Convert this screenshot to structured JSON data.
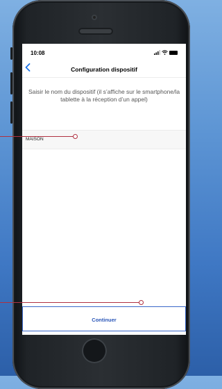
{
  "status_bar": {
    "time": "10:08"
  },
  "nav": {
    "title": "Configuration dispositif",
    "back_icon": "chevron-left-icon"
  },
  "instruction": "Saisir le nom du dispositif (il s’affiche sur le smartphone/la tablette à la réception d’un appel)",
  "device_name": {
    "value": "MAISON"
  },
  "continue_button": {
    "label": "Continuer"
  },
  "colors": {
    "accent": "#2a56b8",
    "callout": "#b03040",
    "background_blue": "#4a85cf"
  }
}
